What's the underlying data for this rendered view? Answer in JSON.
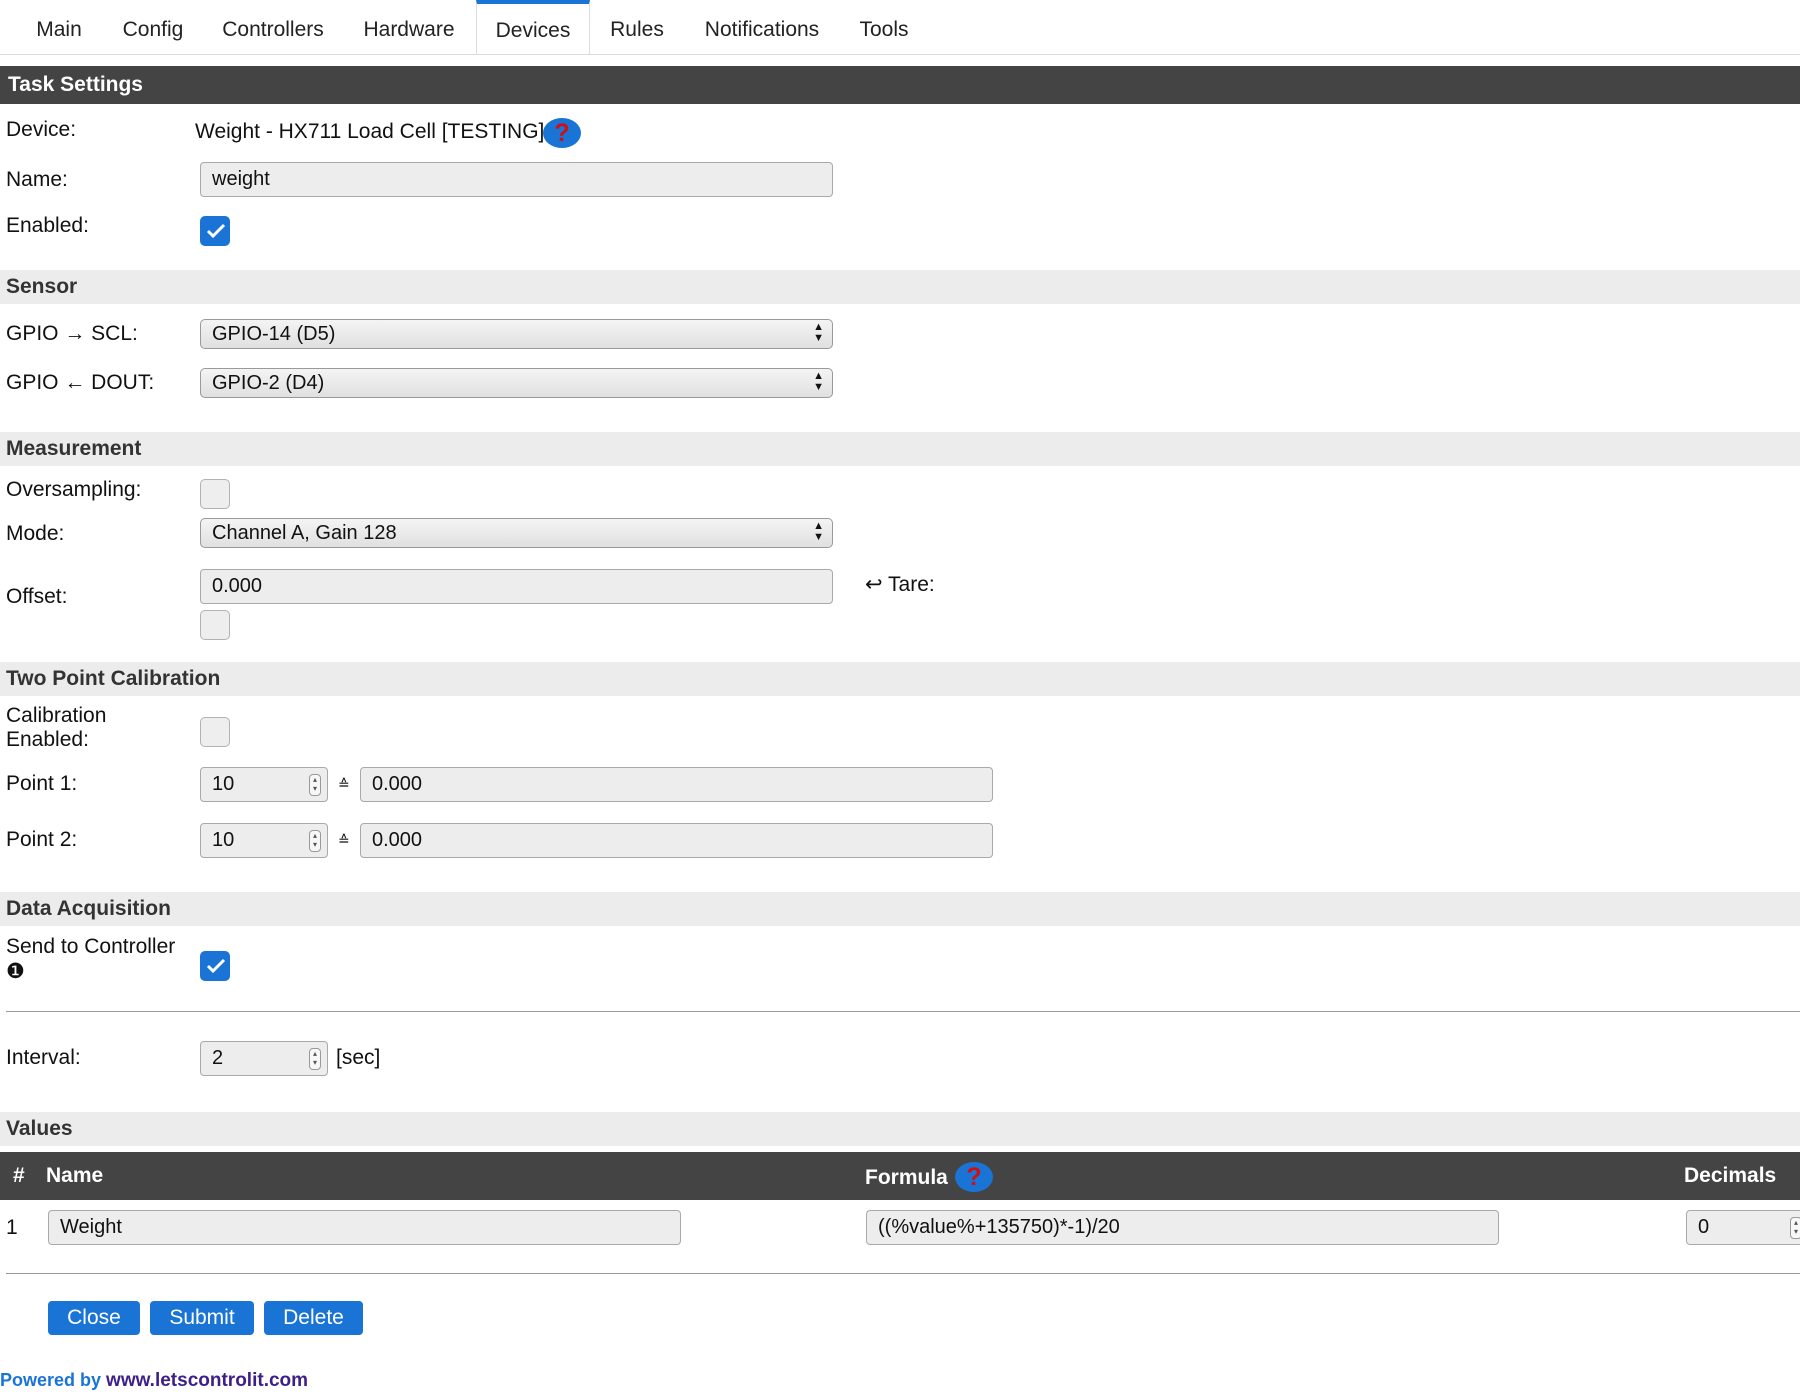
{
  "nav": {
    "tabs": [
      {
        "label": "Main"
      },
      {
        "label": "Config"
      },
      {
        "label": "Controllers"
      },
      {
        "label": "Hardware"
      },
      {
        "label": "Devices"
      },
      {
        "label": "Rules"
      },
      {
        "label": "Notifications"
      },
      {
        "label": "Tools"
      }
    ],
    "active": "Devices"
  },
  "task": {
    "title": "Task Settings",
    "device_label": "Device:",
    "device_value": "Weight - HX711 Load Cell [TESTING]",
    "name_label": "Name:",
    "name_value": "weight",
    "enabled_label": "Enabled:",
    "enabled": true
  },
  "sensor": {
    "title": "Sensor",
    "scl_label": "GPIO → SCL:",
    "scl_value": "GPIO-14 (D5)",
    "dout_label": "GPIO ← DOUT:",
    "dout_value": "GPIO-2 (D4)"
  },
  "measurement": {
    "title": "Measurement",
    "oversampling_label": "Oversampling:",
    "oversampling": false,
    "mode_label": "Mode:",
    "mode_value": "Channel A, Gain 128",
    "offset_label": "Offset:",
    "offset_value": "0.000",
    "tare_label": "↩ Tare:",
    "tare": false
  },
  "calibration": {
    "title": "Two Point Calibration",
    "enabled_label_1": "Calibration",
    "enabled_label_2": "Enabled:",
    "enabled": false,
    "point1_label": "Point 1:",
    "point1_raw": "10",
    "point1_value": "0.000",
    "point2_label": "Point 2:",
    "point2_raw": "10",
    "point2_value": "0.000",
    "equals_symbol": "≙"
  },
  "acquisition": {
    "title": "Data Acquisition",
    "send_label": "Send to Controller",
    "send_index": "❶",
    "send": true,
    "interval_label": "Interval:",
    "interval_value": "2",
    "interval_unit": "[sec]"
  },
  "values": {
    "title": "Values",
    "headers": {
      "index": "#",
      "name": "Name",
      "formula": "Formula",
      "decimals": "Decimals"
    },
    "rows": [
      {
        "index": "1",
        "name": "Weight",
        "formula": "((%value%+135750)*-1)/20",
        "decimals": "0"
      }
    ]
  },
  "buttons": {
    "close": "Close",
    "submit": "Submit",
    "delete": "Delete"
  },
  "footer": {
    "powered": "Powered by",
    "link": "www.letscontrolit.com"
  },
  "colors": {
    "accent": "#1a74d6",
    "header_bg": "#444444",
    "section_bg": "#ececec"
  }
}
